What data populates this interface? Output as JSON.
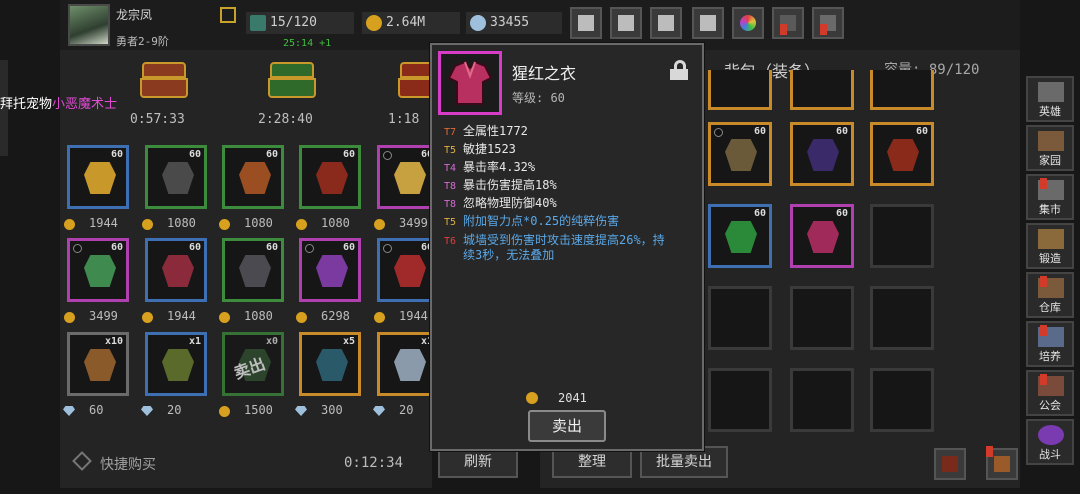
{
  "player": {
    "name": "龙宗凤",
    "rank": "勇者2-9阶"
  },
  "resources": {
    "energy": "15/120",
    "energy_timer": "25:14 +1",
    "gold": "2.64M",
    "gems": "33455"
  },
  "top_buttons": [
    "shop-cart",
    "mail",
    "gamepad",
    "settings",
    "color-wheel",
    "event-1",
    "event-2"
  ],
  "pet_text": {
    "prefix": "拜托宠物",
    "name": "小恶魔术士"
  },
  "chests": [
    {
      "color": "#8a3a1e",
      "timer": "0:57:33"
    },
    {
      "color": "#2f6a2a",
      "timer": "2:28:40"
    },
    {
      "color": "#8a2a18",
      "timer": "1:18"
    }
  ],
  "shop_items": [
    {
      "count": "60",
      "border": "#3f6fb3",
      "price": "1944",
      "currency": "coin",
      "art": "#c9982a"
    },
    {
      "count": "60",
      "border": "#3d8c3d",
      "price": "1080",
      "currency": "coin",
      "art": "#4a4a4a"
    },
    {
      "count": "60",
      "border": "#3d8c3d",
      "price": "1080",
      "currency": "coin",
      "art": "#9a4e22"
    },
    {
      "count": "60",
      "border": "#3d8c3d",
      "price": "1080",
      "currency": "coin",
      "art": "#8a2a1c"
    },
    {
      "count": "60",
      "border": "#b040b0",
      "price": "3499",
      "currency": "coin",
      "art": "#c7a040",
      "dot": true
    },
    {
      "count": "60",
      "border": "#b040b0",
      "price": "3499",
      "currency": "coin",
      "art": "#3f8a4f",
      "dot": true
    },
    {
      "count": "60",
      "border": "#3f6fb3",
      "price": "1944",
      "currency": "coin",
      "art": "#8a2a3a"
    },
    {
      "count": "60",
      "border": "#3d8c3d",
      "price": "1080",
      "currency": "coin",
      "art": "#4a4a50"
    },
    {
      "count": "60",
      "border": "#b040b0",
      "price": "6298",
      "currency": "coin",
      "art": "#7a3aa0",
      "dot": true
    },
    {
      "count": "60",
      "border": "#3f6fb3",
      "price": "1944",
      "currency": "coin",
      "art": "#a02a2a",
      "dot": true
    },
    {
      "count": "x10",
      "border": "#6b6b6b",
      "price": "60",
      "currency": "gem",
      "art": "#8a5a2a"
    },
    {
      "count": "x1",
      "border": "#3f6fb3",
      "price": "20",
      "currency": "gem",
      "art": "#5a6a2a"
    },
    {
      "count": "x0",
      "border": "#3d8c3d",
      "price": "1500",
      "currency": "coin",
      "art": "#2f4f2f",
      "sold": "卖出"
    },
    {
      "count": "x5",
      "border": "#c98a2a",
      "price": "300",
      "currency": "gem",
      "art": "#2a5a6a"
    },
    {
      "count": "x1",
      "border": "#c98a2a",
      "price": "20",
      "currency": "gem",
      "art": "#8a9aaa"
    }
  ],
  "shop_footer": {
    "quick_buy": "快捷购买",
    "timer": "0:12:34",
    "refresh": "刷新"
  },
  "bag": {
    "title": "背包（装备）",
    "capacity": "容量: 89/120",
    "sort": "整理",
    "batch_sell": "批量卖出",
    "items": [
      {
        "count": "60",
        "border": "#c98a2a",
        "art": "#6a5a3a",
        "dot": true
      },
      {
        "count": "60",
        "border": "#c98a2a",
        "art": "#3a2a6a"
      },
      {
        "count": "60",
        "border": "#c98a2a",
        "art": "#8a2a1a"
      },
      {
        "count": "60",
        "border": "#3f6fb3",
        "art": "#2a8a3a"
      },
      {
        "count": "60",
        "border": "#b040b0",
        "art": "#a02a5a"
      }
    ]
  },
  "sidebar": [
    {
      "label": "英雄",
      "alert": false
    },
    {
      "label": "家园",
      "alert": false
    },
    {
      "label": "集市",
      "alert": true
    },
    {
      "label": "锻造",
      "alert": false
    },
    {
      "label": "仓库",
      "alert": true
    },
    {
      "label": "培养",
      "alert": true
    },
    {
      "label": "公会",
      "alert": true
    },
    {
      "label": "战斗",
      "alert": false
    }
  ],
  "tooltip": {
    "name": "猩红之衣",
    "level": "等级: 60",
    "attributes": [
      {
        "tier": "T7",
        "text": "全属性1772",
        "tier_color": "#e06a3a",
        "text_color": "#e8e8e8"
      },
      {
        "tier": "T5",
        "text": "敏捷1523",
        "tier_color": "#e0b03a",
        "text_color": "#e8e8e8"
      },
      {
        "tier": "T4",
        "text": "暴击率4.32%",
        "tier_color": "#d66ad6",
        "text_color": "#e8e8e8"
      },
      {
        "tier": "T8",
        "text": "暴击伤害提高18%",
        "tier_color": "#d66ad6",
        "text_color": "#e8e8e8"
      },
      {
        "tier": "T8",
        "text": "忽略物理防御40%",
        "tier_color": "#d66ad6",
        "text_color": "#e8e8e8"
      },
      {
        "tier": "T5",
        "text": "附加智力点*0.25的纯粹伤害",
        "tier_color": "#e0b03a",
        "text_color": "#5aa8e8"
      },
      {
        "tier": "T6",
        "text": "城墙受到伤害时攻击速度提高26%，持",
        "tier_color": "#e04040",
        "text_color": "#5aa8e8"
      },
      {
        "tier": "",
        "text": "续3秒，无法叠加",
        "tier_color": "#e04040",
        "text_color": "#5aa8e8"
      }
    ],
    "sell_price": "2041",
    "sell_button": "卖出"
  }
}
